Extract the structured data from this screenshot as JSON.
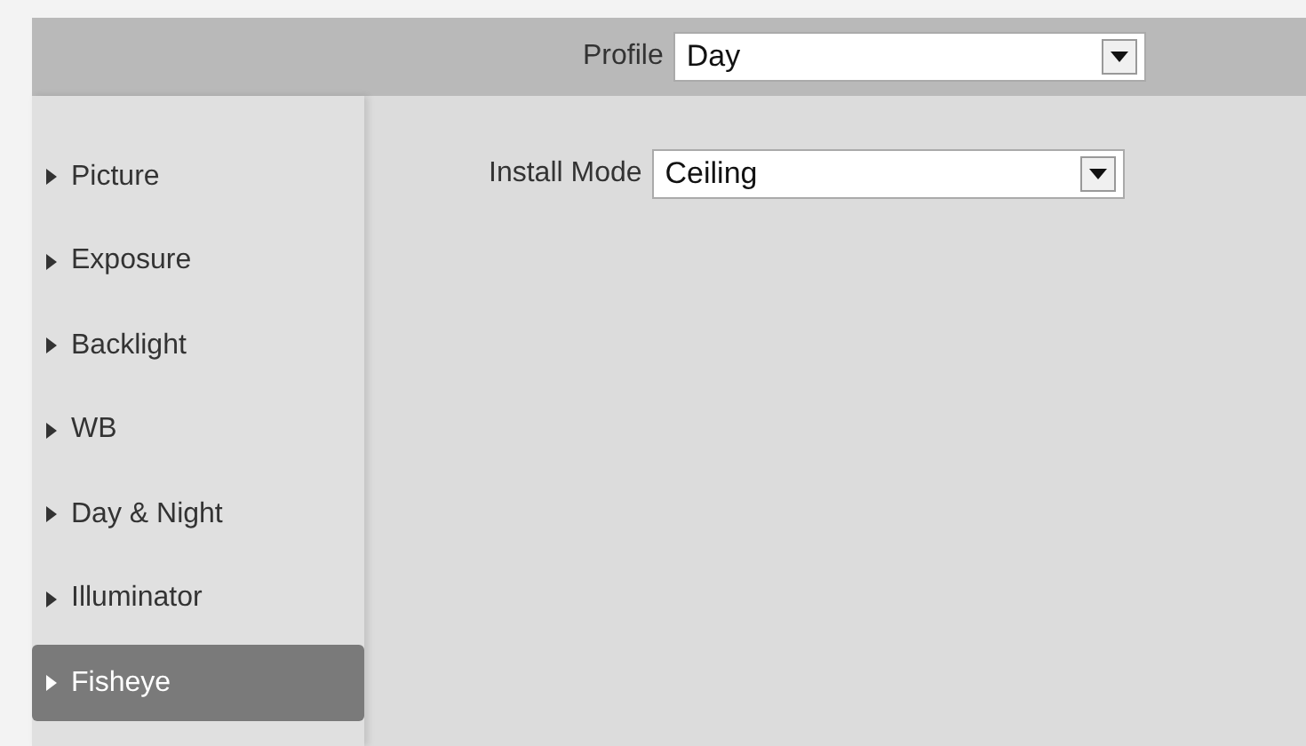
{
  "profile": {
    "label": "Profile",
    "value": "Day"
  },
  "sidebar": {
    "items": [
      {
        "label": "Picture",
        "selected": false
      },
      {
        "label": "Exposure",
        "selected": false
      },
      {
        "label": "Backlight",
        "selected": false
      },
      {
        "label": "WB",
        "selected": false
      },
      {
        "label": "Day & Night",
        "selected": false
      },
      {
        "label": "Illuminator",
        "selected": false
      },
      {
        "label": "Fisheye",
        "selected": true
      }
    ]
  },
  "install_mode": {
    "label": "Install Mode",
    "value": "Ceiling"
  }
}
